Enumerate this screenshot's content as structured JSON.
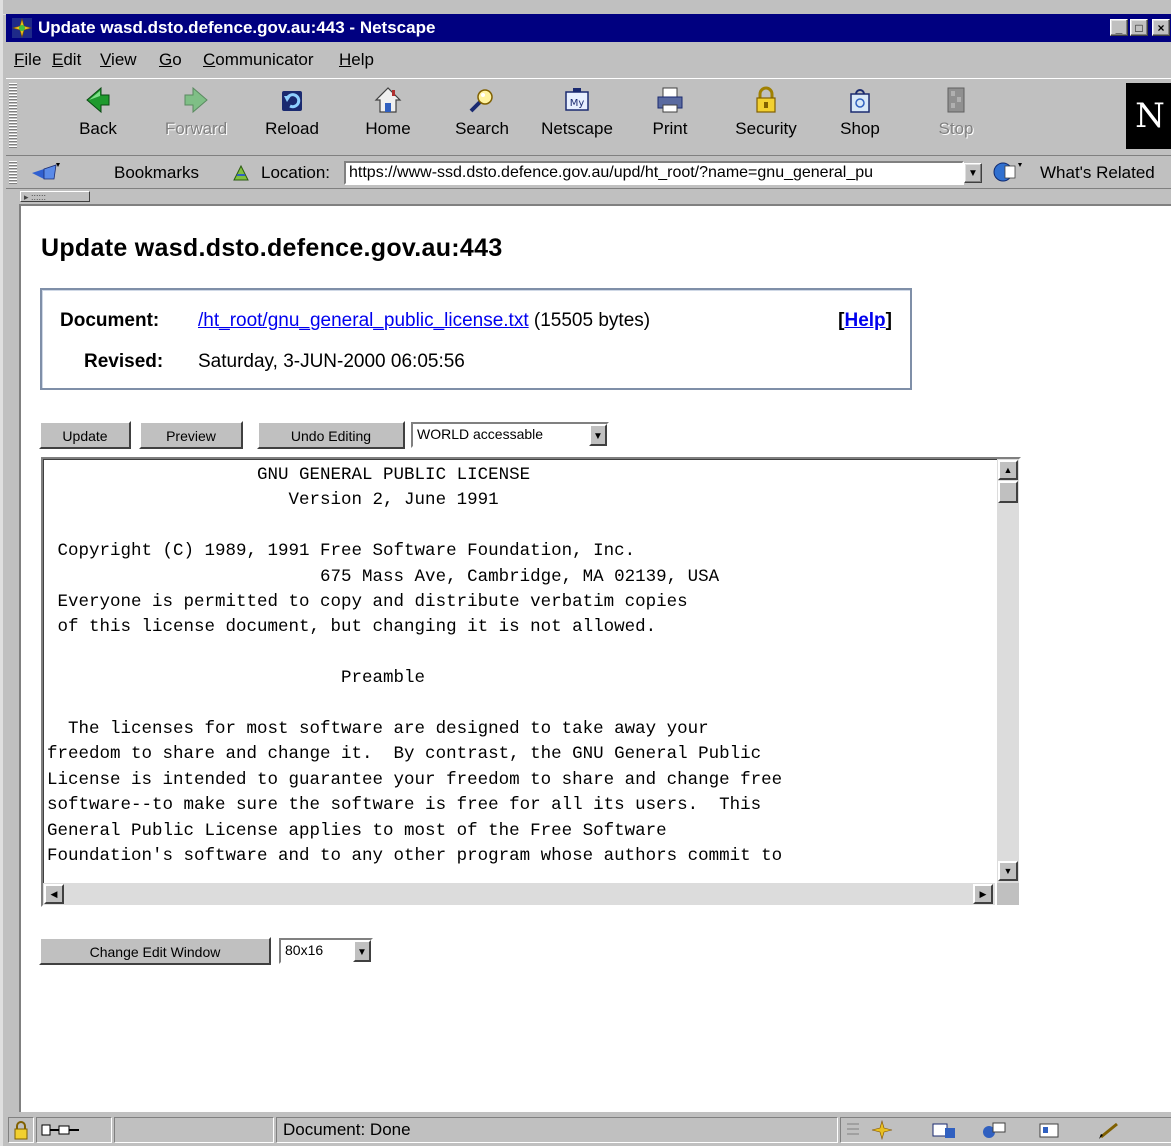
{
  "window": {
    "title": "Update wasd.dsto.defence.gov.au:443 - Netscape",
    "controls": [
      "_",
      "□",
      "×"
    ]
  },
  "menu": [
    "File",
    "Edit",
    "View",
    "Go",
    "Communicator",
    "Help"
  ],
  "menu_access": [
    "F",
    "E",
    "V",
    "G",
    "C",
    "H"
  ],
  "toolbar": {
    "buttons": [
      {
        "label": "Back",
        "icon": "back-arrow-icon",
        "enabled": true
      },
      {
        "label": "Forward",
        "icon": "forward-arrow-icon",
        "enabled": false
      },
      {
        "label": "Reload",
        "icon": "reload-icon",
        "enabled": true
      },
      {
        "label": "Home",
        "icon": "home-icon",
        "enabled": true
      },
      {
        "label": "Search",
        "icon": "search-icon",
        "enabled": true
      },
      {
        "label": "Netscape",
        "icon": "my-netscape-icon",
        "enabled": true
      },
      {
        "label": "Print",
        "icon": "print-icon",
        "enabled": true
      },
      {
        "label": "Security",
        "icon": "lock-icon",
        "enabled": true
      },
      {
        "label": "Shop",
        "icon": "shop-bag-icon",
        "enabled": true
      },
      {
        "label": "Stop",
        "icon": "stop-icon",
        "enabled": false
      }
    ],
    "logo_letter": "N"
  },
  "location_bar": {
    "bookmarks_label": "Bookmarks",
    "location_label": "Location:",
    "url": "https://www-ssd.dsto.defence.gov.au/upd/ht_root/?name=gnu_general_pu",
    "whats_related_label": "What's Related"
  },
  "page": {
    "heading": "Update wasd.dsto.defence.gov.au:443",
    "document_label": "Document:",
    "document_link": "/ht_root/gnu_general_public_license.txt",
    "document_size": "(15505 bytes)",
    "help_open": "[",
    "help_label": "Help",
    "help_close": "]",
    "revised_label": "Revised:",
    "revised_value": "Saturday, 3-JUN-2000 06:05:56",
    "buttons": {
      "update": "Update",
      "preview": "Preview",
      "undo": "Undo Editing",
      "change_window": "Change Edit Window"
    },
    "access_select": "WORLD accessable",
    "size_select": "80x16",
    "editor_text": "                    GNU GENERAL PUBLIC LICENSE\n                       Version 2, June 1991\n\n Copyright (C) 1989, 1991 Free Software Foundation, Inc.\n                          675 Mass Ave, Cambridge, MA 02139, USA\n Everyone is permitted to copy and distribute verbatim copies\n of this license document, but changing it is not allowed.\n\n                            Preamble\n\n  The licenses for most software are designed to take away your\nfreedom to share and change it.  By contrast, the GNU General Public\nLicense is intended to guarantee your freedom to share and change free\nsoftware--to make sure the software is free for all its users.  This\nGeneral Public License applies to most of the Free Software\nFoundation's software and to any other program whose authors commit to"
  },
  "status": {
    "text": "Document: Done"
  },
  "colors": {
    "titlebar": "#000080",
    "chrome": "#c0c0c0",
    "link": "#0000ee"
  }
}
